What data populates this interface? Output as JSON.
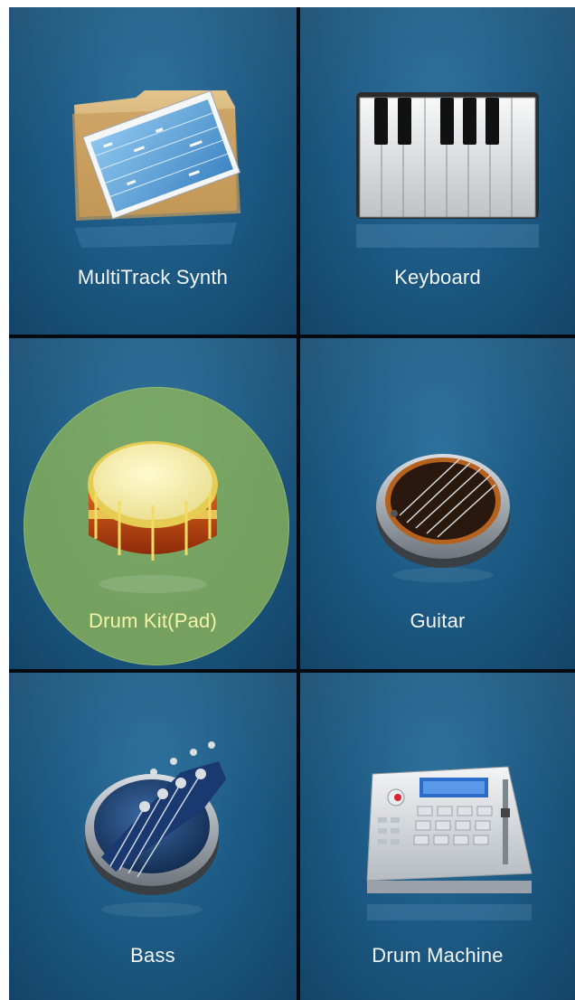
{
  "tiles": [
    {
      "label": "MultiTrack Synth",
      "icon": "multitrack-icon"
    },
    {
      "label": "Keyboard",
      "icon": "piano-keyboard-icon"
    },
    {
      "label": "Drum Kit(Pad)",
      "icon": "drum-icon",
      "selected": true
    },
    {
      "label": "Guitar",
      "icon": "guitar-icon"
    },
    {
      "label": "Bass",
      "icon": "bass-headstock-icon"
    },
    {
      "label": "Drum Machine",
      "icon": "drum-machine-icon"
    }
  ],
  "colors": {
    "tile_bg": "#1d5b85",
    "highlight": "#8fb758",
    "selected_label": "#f3f3a8"
  }
}
